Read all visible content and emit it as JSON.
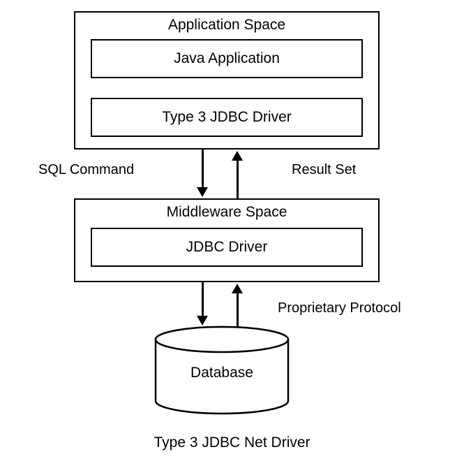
{
  "diagram": {
    "caption": "Type 3 JDBC Net Driver",
    "application_space": {
      "title": "Application Space",
      "java_app": "Java Application",
      "driver": "Type 3 JDBC Driver"
    },
    "labels": {
      "sql_command": "SQL Command",
      "result_set": "Result Set",
      "proprietary_protocol": "Proprietary Protocol"
    },
    "middleware_space": {
      "title": "Middleware Space",
      "jdbc_driver": "JDBC Driver"
    },
    "database": {
      "label": "Database"
    }
  }
}
